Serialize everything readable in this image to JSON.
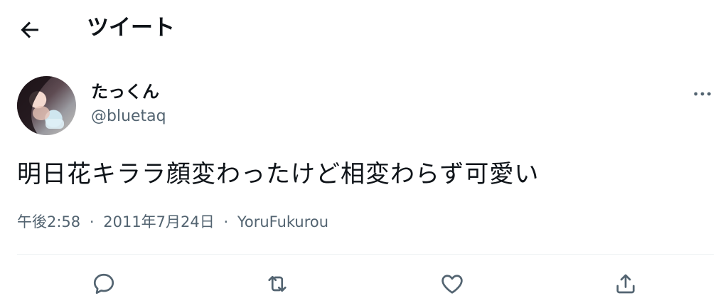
{
  "header": {
    "title": "ツイート"
  },
  "tweet": {
    "display_name": "たっくん",
    "handle": "@bluetaq",
    "text": "明日花キララ顔変わったけど相変わらず可愛い",
    "time": "午後2:58",
    "date": "2011年7月24日",
    "separator": "·",
    "client": "YoruFukurou"
  },
  "icons": {
    "back": "arrow-left-icon",
    "more": "more-horizontal-icon",
    "reply": "reply-bubble-icon",
    "retweet": "retweet-icon",
    "like": "heart-icon",
    "share": "share-icon"
  },
  "colors": {
    "text": "#0f1419",
    "secondary": "#536471",
    "divider": "#eff3f4"
  }
}
